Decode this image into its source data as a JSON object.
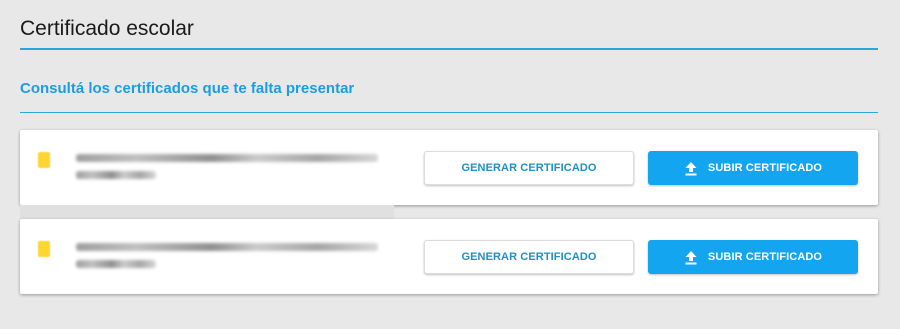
{
  "page": {
    "title": "Certificado escolar",
    "subtitle": "Consultá los certificados que te falta presentar"
  },
  "certificates": [
    {
      "generate_label": "GENERAR CERTIFICADO",
      "upload_label": "SUBIR CERTIFICADO"
    },
    {
      "generate_label": "GENERAR CERTIFICADO",
      "upload_label": "SUBIR CERTIFICADO"
    }
  ],
  "colors": {
    "accent": "#2aa6df",
    "subtitle": "#1a9ee0",
    "upload_button": "#13a5ef",
    "background": "#e8e8e8",
    "badge": "#ffd21a"
  },
  "icons": {
    "upload": "upload-icon"
  }
}
